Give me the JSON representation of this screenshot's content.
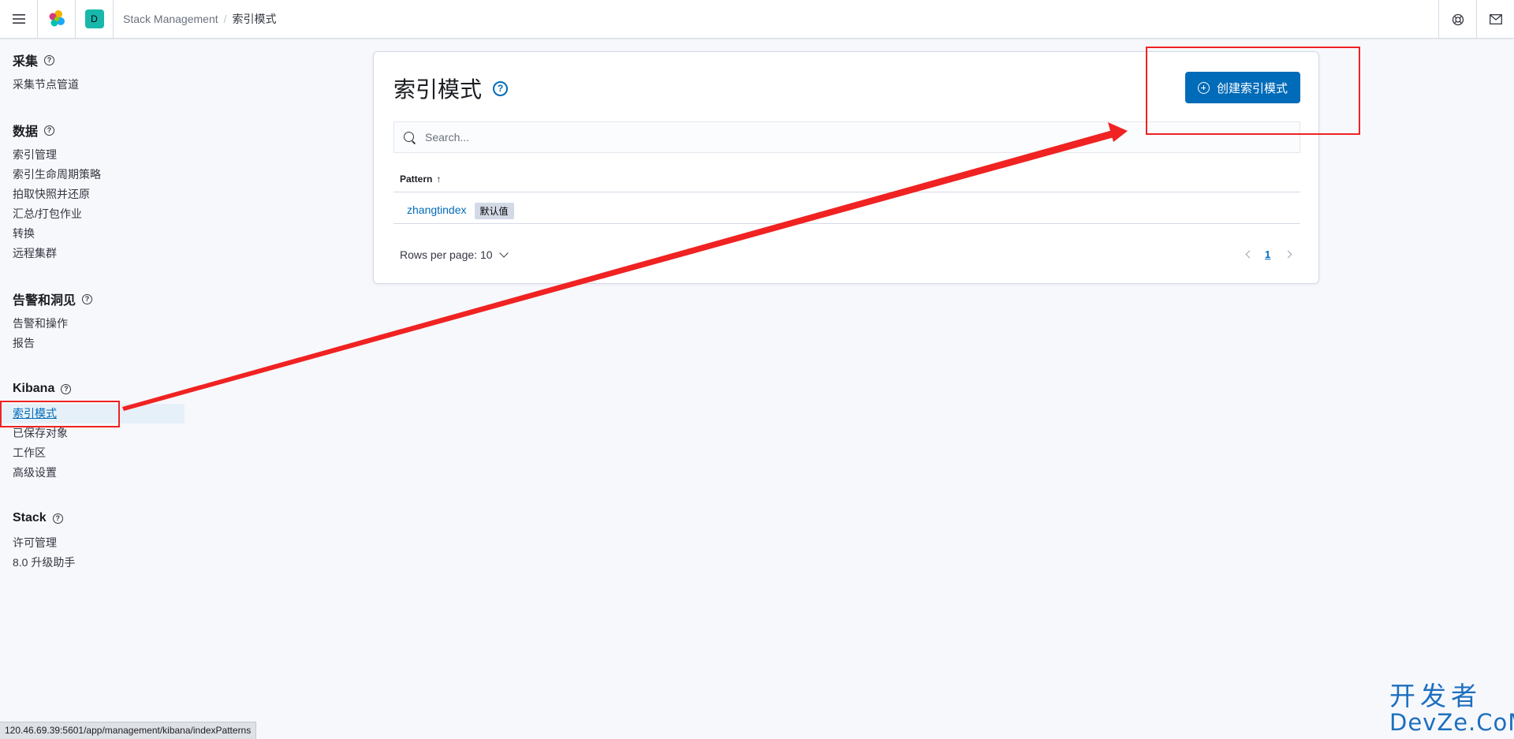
{
  "header": {
    "space_initial": "D",
    "breadcrumb": [
      "Stack Management",
      "索引模式"
    ]
  },
  "sidebar": {
    "groups": [
      {
        "title": "采集",
        "items": [
          "采集节点管道"
        ]
      },
      {
        "title": "数据",
        "items": [
          "索引管理",
          "索引生命周期策略",
          "拍取快照并还原",
          "汇总/打包作业",
          "转换",
          "远程集群"
        ]
      },
      {
        "title": "告警和洞见",
        "items": [
          "告警和操作",
          "报告"
        ]
      },
      {
        "title": "Kibana",
        "items": [
          "索引模式",
          "已保存对象",
          "工作区",
          "高级设置"
        ]
      },
      {
        "title": "Stack",
        "items": [
          "许可管理",
          "8.0 升级助手"
        ]
      }
    ],
    "active_item": "索引模式"
  },
  "main": {
    "title": "索引模式",
    "create_button": "创建索引模式",
    "search_placeholder": "Search...",
    "table": {
      "column": "Pattern",
      "rows": [
        {
          "name": "zhangtindex",
          "badge": "默认值"
        }
      ]
    },
    "rows_per_page": "Rows per page: 10",
    "current_page": "1"
  },
  "status_url": "120.46.69.39:5601/app/management/kibana/indexPatterns",
  "watermark": {
    "top": "开发者",
    "bottom": "DevZe.CoM"
  },
  "colors": {
    "primary": "#006bb8",
    "avatar": "#17b8ab",
    "annotation": "#f02222",
    "watermark": "#1d6fbf"
  }
}
